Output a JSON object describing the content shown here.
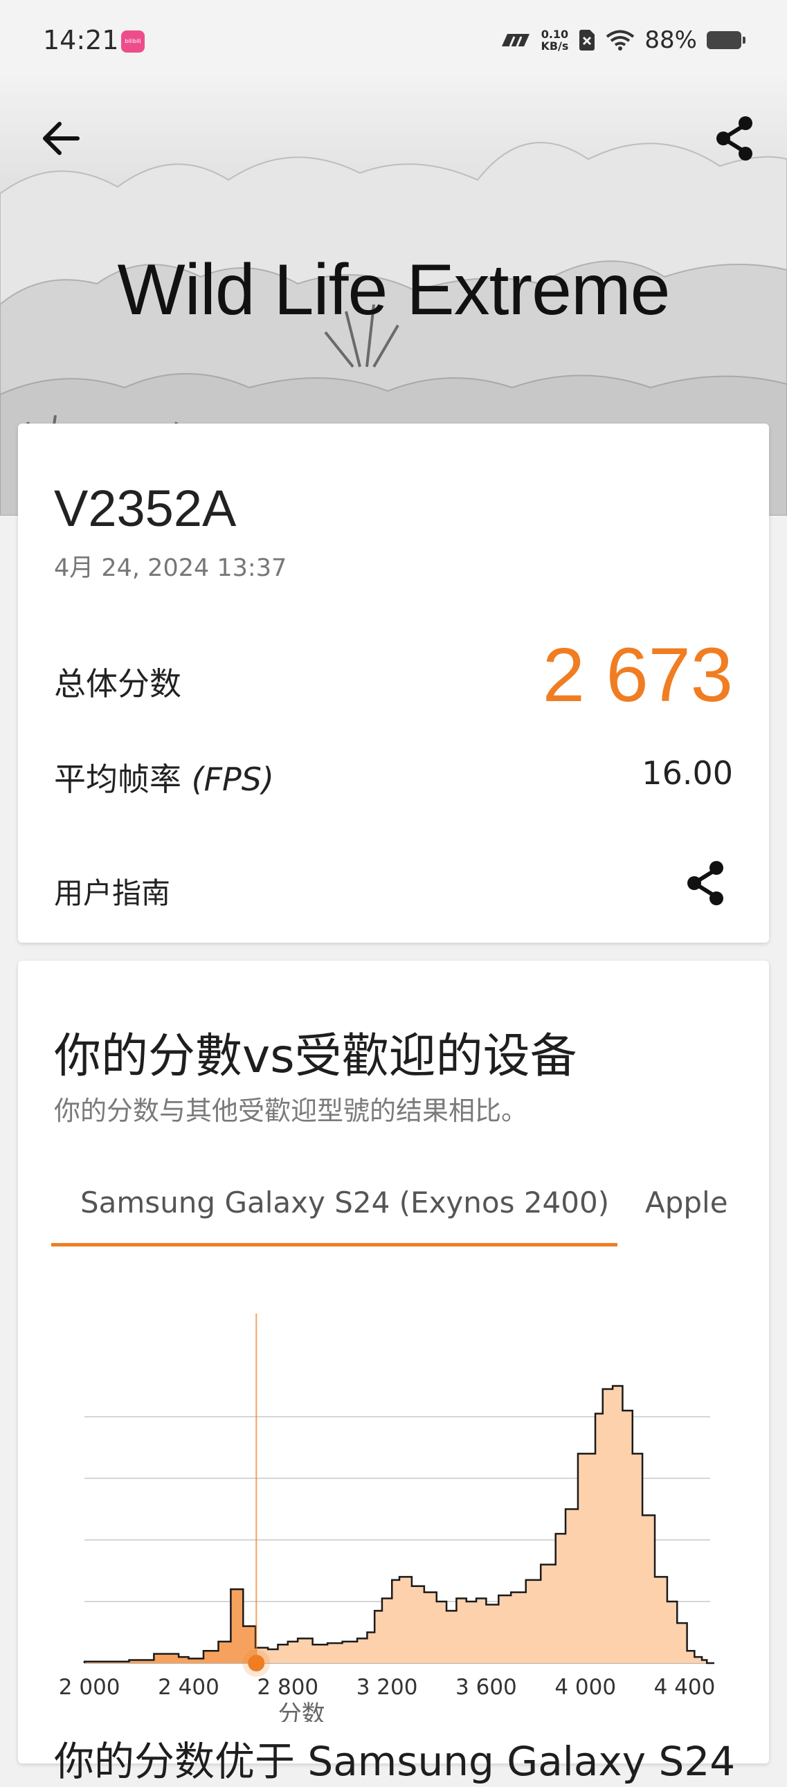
{
  "status_bar": {
    "time": "14:21",
    "app_badge": "bilibili",
    "net_speed_value": "0.10",
    "net_speed_unit": "KB/s",
    "battery": "88%",
    "icons": [
      "carrier-icon",
      "sim-x-icon",
      "wifi-icon",
      "battery-icon"
    ]
  },
  "header": {
    "title": "Wild Life Extreme",
    "back_icon": "arrow-left-icon",
    "share_icon": "share-icon"
  },
  "result": {
    "device": "V2352A",
    "date": "4月 24, 2024 13:37",
    "overall_label": "总体分数",
    "overall_score": "2 673",
    "fps_label": "平均帧率",
    "fps_suffix": "(FPS)",
    "fps_value": "16.00",
    "guide_label": "用户指南"
  },
  "comparison": {
    "title": "你的分數vs受歡迎的设备",
    "subtitle": "你的分数与其他受歡迎型號的结果相比。",
    "tabs": [
      "Samsung Galaxy S24 (Exynos 2400)",
      "Apple"
    ],
    "active_tab": 0,
    "footer_text": "你的分数优于 Samsung Galaxy S24"
  },
  "colors": {
    "accent": "#f07d22",
    "fill_light": "#fdd1ac",
    "fill_dark": "#f6a25e"
  },
  "chart_data": {
    "type": "area",
    "xlabel": "分数",
    "ylabel": "",
    "xlim": [
      1980,
      4520
    ],
    "ylim": [
      0,
      100
    ],
    "x_ticks": [
      "2 000",
      "2 400",
      "2 800",
      "3 200",
      "3 600",
      "4 000",
      "4 400"
    ],
    "x_tick_values": [
      2000,
      2400,
      2800,
      3200,
      3600,
      4000,
      4400
    ],
    "gridlines": [
      20,
      40,
      60,
      80
    ],
    "marker_score": 2673,
    "series": [
      {
        "bins": [
          [
            1980,
            2040,
            0.5
          ],
          [
            2040,
            2100,
            0.5
          ],
          [
            2100,
            2160,
            0.5
          ],
          [
            2160,
            2260,
            1
          ],
          [
            2260,
            2280,
            3
          ],
          [
            2280,
            2360,
            3
          ],
          [
            2360,
            2400,
            2
          ],
          [
            2400,
            2460,
            1.5
          ],
          [
            2460,
            2520,
            4
          ],
          [
            2520,
            2570,
            7
          ],
          [
            2570,
            2620,
            24
          ],
          [
            2620,
            2670,
            12
          ],
          [
            2670,
            2720,
            5
          ],
          [
            2720,
            2760,
            4.5
          ],
          [
            2760,
            2800,
            6
          ],
          [
            2800,
            2840,
            7
          ],
          [
            2840,
            2900,
            8
          ],
          [
            2900,
            2960,
            6
          ],
          [
            2960,
            3020,
            6.5
          ],
          [
            3020,
            3080,
            7
          ],
          [
            3080,
            3120,
            8
          ],
          [
            3120,
            3150,
            10
          ],
          [
            3150,
            3180,
            17
          ],
          [
            3180,
            3220,
            21
          ],
          [
            3220,
            3250,
            27
          ],
          [
            3250,
            3300,
            28
          ],
          [
            3300,
            3350,
            25
          ],
          [
            3350,
            3400,
            23
          ],
          [
            3400,
            3440,
            20
          ],
          [
            3440,
            3480,
            17
          ],
          [
            3480,
            3520,
            21
          ],
          [
            3520,
            3560,
            20
          ],
          [
            3560,
            3600,
            21
          ],
          [
            3600,
            3650,
            19
          ],
          [
            3650,
            3700,
            22
          ],
          [
            3700,
            3760,
            23
          ],
          [
            3760,
            3820,
            27
          ],
          [
            3820,
            3880,
            32
          ],
          [
            3880,
            3920,
            42
          ],
          [
            3920,
            3970,
            50
          ],
          [
            3970,
            4040,
            68
          ],
          [
            4040,
            4070,
            81
          ],
          [
            4070,
            4110,
            89
          ],
          [
            4110,
            4150,
            90
          ],
          [
            4150,
            4190,
            82
          ],
          [
            4190,
            4230,
            68
          ],
          [
            4230,
            4280,
            48
          ],
          [
            4280,
            4330,
            28
          ],
          [
            4330,
            4370,
            20
          ],
          [
            4370,
            4410,
            13
          ],
          [
            4410,
            4440,
            4
          ],
          [
            4440,
            4470,
            2
          ],
          [
            4470,
            4490,
            1
          ],
          [
            4490,
            4520,
            0
          ]
        ]
      }
    ]
  }
}
